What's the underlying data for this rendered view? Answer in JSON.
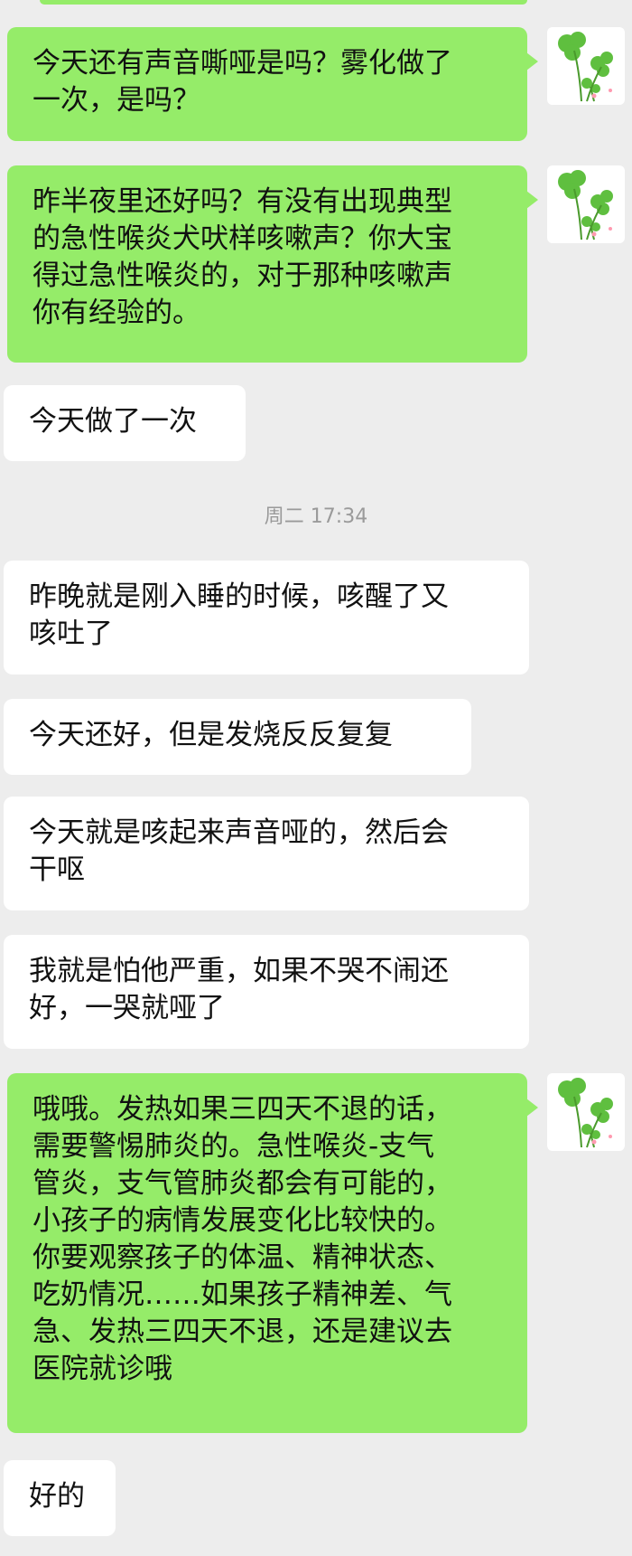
{
  "chat": {
    "timestamp": "周二 17:34",
    "messages": [
      {
        "side": "out",
        "text": "今天还有声音嘶哑是吗？雾化做了\n一次，是吗？"
      },
      {
        "side": "out",
        "text": "昨半夜里还好吗？有没有出现典型\n的急性喉炎犬吠样咳嗽声？你大宝\n得过急性喉炎的，对于那种咳嗽声\n你有经验的。"
      },
      {
        "side": "in",
        "text": "今天做了一次"
      },
      {
        "side": "in",
        "text": "昨晚就是刚入睡的时候，咳醒了又\n咳吐了"
      },
      {
        "side": "in",
        "text": "今天还好，但是发烧反反复复"
      },
      {
        "side": "in",
        "text": "今天就是咳起来声音哑的，然后会\n干呕"
      },
      {
        "side": "in",
        "text": "我就是怕他严重，如果不哭不闹还\n好，一哭就哑了"
      },
      {
        "side": "out",
        "text": "哦哦。发热如果三四天不退的话，\n需要警惕肺炎的。急性喉炎-支气\n管炎，支气管肺炎都会有可能的，\n小孩子的病情发展变化比较快的。\n你要观察孩子的体温、精神状态、\n吃奶情况……如果孩子精神差、气\n急、发热三四天不退，还是建议去\n医院就诊哦"
      },
      {
        "side": "in",
        "text": "好的"
      }
    ],
    "avatar_icon": "clover-plant-icon",
    "colors": {
      "outgoing": "#95ec69",
      "incoming": "#ffffff",
      "background": "#ededed"
    }
  }
}
